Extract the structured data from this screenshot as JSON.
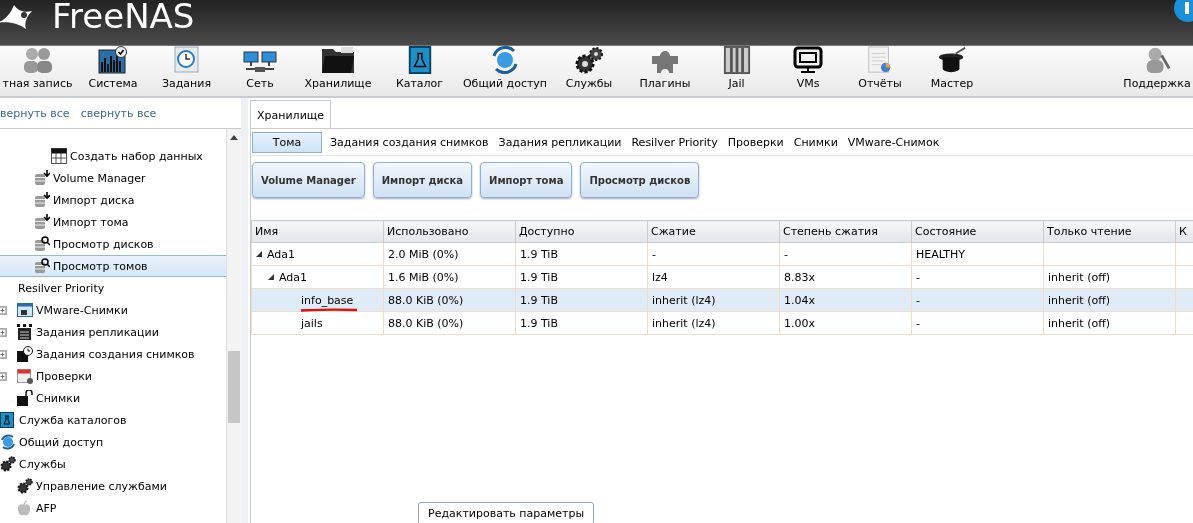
{
  "header": {
    "title": "FreeNAS"
  },
  "toolbar": {
    "items": [
      {
        "label": "тная запись"
      },
      {
        "label": "Система"
      },
      {
        "label": "Задания"
      },
      {
        "label": "Сеть"
      },
      {
        "label": "Хранилище"
      },
      {
        "label": "Каталог"
      },
      {
        "label": "Общий доступ"
      },
      {
        "label": "Службы"
      },
      {
        "label": "Плагины"
      },
      {
        "label": "Jail"
      },
      {
        "label": "VMs"
      },
      {
        "label": "Отчёты"
      },
      {
        "label": "Мастер"
      },
      {
        "label": "Поддержка"
      }
    ]
  },
  "sidebar": {
    "links": [
      "вернуть все",
      "свернуть все"
    ],
    "tree": [
      {
        "children": [
          {
            "children": [
              {
                "children": [
                  {
                    "label": "Создать набор данных",
                    "selected": false,
                    "collapsed": false
                  }
                ]
              },
              {
                "label": "Volume Manager",
                "selected": false,
                "collapsed": false
              },
              {
                "label": "Импорт диска",
                "selected": false,
                "collapsed": false
              },
              {
                "label": "Импорт тома",
                "selected": false,
                "collapsed": false
              },
              {
                "label": "Просмотр дисков",
                "selected": false,
                "collapsed": false
              },
              {
                "label": "Просмотр томов",
                "selected": true,
                "collapsed": false
              }
            ]
          },
          {
            "label": "Resilver Priority",
            "selected": false,
            "collapsed": false
          },
          {
            "label": "VMware-Снимки",
            "selected": false,
            "collapsed": true
          },
          {
            "label": "Задания репликации",
            "selected": false,
            "collapsed": true
          },
          {
            "label": "Задания создания снимков",
            "selected": false,
            "collapsed": true
          },
          {
            "label": "Проверки",
            "selected": false,
            "collapsed": true
          },
          {
            "label": "Снимки",
            "selected": false,
            "collapsed": false
          }
        ]
      },
      {
        "label": "Служба каталогов",
        "selected": false,
        "collapsed": false
      },
      {
        "label": "Общий доступ",
        "selected": false,
        "collapsed": false
      },
      {
        "label": "Службы",
        "selected": false,
        "collapsed": false,
        "children": [
          {
            "label": "Управление службами",
            "selected": false,
            "collapsed": false
          },
          {
            "label": "AFP",
            "selected": false,
            "collapsed": false
          }
        ]
      }
    ]
  },
  "main": {
    "tabs": [
      {
        "label": "Хранилище",
        "selected": true
      }
    ],
    "subtabs": [
      {
        "label": "Тома",
        "selected": true
      },
      {
        "label": "Задания создания снимков",
        "selected": false
      },
      {
        "label": "Задания репликации",
        "selected": false
      },
      {
        "label": "Resilver Priority",
        "selected": false
      },
      {
        "label": "Проверки",
        "selected": false
      },
      {
        "label": "Снимки",
        "selected": false
      },
      {
        "label": "VMware-Снимок",
        "selected": false
      }
    ],
    "actions": [
      "Volume Manager",
      "Импорт диска",
      "Импорт тома",
      "Просмотр дисков"
    ],
    "table": {
      "columns": [
        "Имя",
        "Использовано",
        "Доступно",
        "Сжатие",
        "Степень сжатия",
        "Состояние",
        "Только чтение",
        "К"
      ],
      "rows": [
        {
          "cells": [
            "Ada1",
            "2.0 MiB (0%)",
            "1.9 TiB",
            "-",
            "-",
            "HEALTHY",
            ""
          ],
          "expanded": true,
          "selected": false,
          "underlined": false,
          "children": [
            {
              "cells": [
                "Ada1",
                "1.6 MiB (0%)",
                "1.9 TiB",
                "lz4",
                "8.83x",
                "-",
                "inherit (off)"
              ],
              "expanded": true,
              "selected": false,
              "underlined": false,
              "children": [
                {
                  "cells": [
                    "info_base",
                    "88.0 KiB (0%)",
                    "1.9 TiB",
                    "inherit (lz4)",
                    "1.04x",
                    "-",
                    "inherit (off)"
                  ],
                  "selected": true,
                  "underlined": true
                },
                {
                  "cells": [
                    "jails",
                    "88.0 KiB (0%)",
                    "1.9 TiB",
                    "inherit (lz4)",
                    "1.00x",
                    "-",
                    "inherit (off)"
                  ],
                  "selected": false,
                  "underlined": false
                }
              ]
            }
          ]
        }
      ]
    },
    "popup_button": "Редактировать параметры"
  }
}
